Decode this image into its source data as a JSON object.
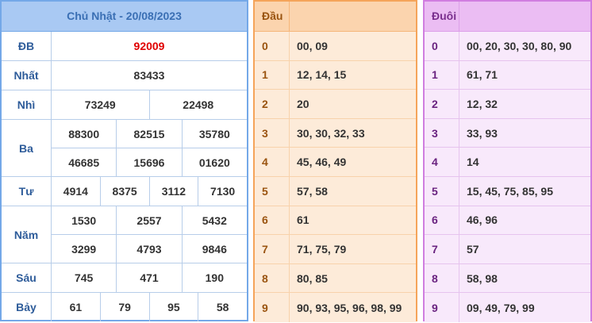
{
  "results": {
    "title": "Chủ Nhật - 20/08/2023",
    "prizes": [
      {
        "label": "ĐB",
        "lines": [
          [
            "92009"
          ]
        ]
      },
      {
        "label": "Nhất",
        "lines": [
          [
            "83433"
          ]
        ]
      },
      {
        "label": "Nhì",
        "lines": [
          [
            "73249",
            "22498"
          ]
        ]
      },
      {
        "label": "Ba",
        "lines": [
          [
            "88300",
            "82515",
            "35780"
          ],
          [
            "46685",
            "15696",
            "01620"
          ]
        ]
      },
      {
        "label": "Tư",
        "lines": [
          [
            "4914",
            "8375",
            "3112",
            "7130"
          ]
        ]
      },
      {
        "label": "Năm",
        "lines": [
          [
            "1530",
            "2557",
            "5432"
          ],
          [
            "3299",
            "4793",
            "9846"
          ]
        ]
      },
      {
        "label": "Sáu",
        "lines": [
          [
            "745",
            "471",
            "190"
          ]
        ]
      },
      {
        "label": "Bảy",
        "lines": [
          [
            "61",
            "79",
            "95",
            "58"
          ]
        ]
      }
    ],
    "special_color": "#e00000"
  },
  "dau": {
    "title": "Đầu",
    "rows": [
      {
        "k": "0",
        "v": "00, 09"
      },
      {
        "k": "1",
        "v": "12, 14, 15"
      },
      {
        "k": "2",
        "v": "20"
      },
      {
        "k": "3",
        "v": "30, 30, 32, 33"
      },
      {
        "k": "4",
        "v": "45, 46, 49"
      },
      {
        "k": "5",
        "v": "57, 58"
      },
      {
        "k": "6",
        "v": "61"
      },
      {
        "k": "7",
        "v": "71, 75, 79"
      },
      {
        "k": "8",
        "v": "80, 85"
      },
      {
        "k": "9",
        "v": "90, 93, 95, 96, 98, 99"
      }
    ]
  },
  "duoi": {
    "title": "Đuôi",
    "rows": [
      {
        "k": "0",
        "v": "00, 20, 30, 30, 80, 90"
      },
      {
        "k": "1",
        "v": "61, 71"
      },
      {
        "k": "2",
        "v": "12, 32"
      },
      {
        "k": "3",
        "v": "33, 93"
      },
      {
        "k": "4",
        "v": "14"
      },
      {
        "k": "5",
        "v": "15, 45, 75, 85, 95"
      },
      {
        "k": "6",
        "v": "46, 96"
      },
      {
        "k": "7",
        "v": "57"
      },
      {
        "k": "8",
        "v": "58, 98"
      },
      {
        "k": "9",
        "v": "09, 49, 79, 99"
      }
    ]
  }
}
